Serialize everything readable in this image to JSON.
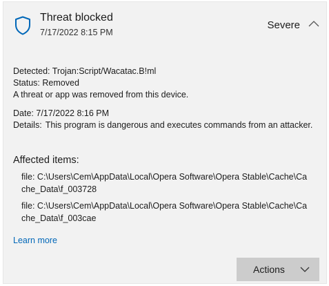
{
  "threat": {
    "title": "Threat blocked",
    "timestamp": "7/17/2022 8:15 PM",
    "severity": "Severe"
  },
  "details": {
    "detected_label": "Detected:",
    "detected_value": "Trojan:Script/Wacatac.B!ml",
    "status_label": "Status:",
    "status_value": "Removed",
    "status_message": "A threat or app was removed from this device.",
    "date_label": "Date:",
    "date_value": "7/17/2022 8:16 PM",
    "details_label": "Details:",
    "details_value": "This program is dangerous and executes commands from an attacker."
  },
  "affected": {
    "title": "Affected items:",
    "items": [
      "file: C:\\Users\\Cem\\AppData\\Local\\Opera Software\\Opera Stable\\Cache\\Cache_Data\\f_003728",
      "file: C:\\Users\\Cem\\AppData\\Local\\Opera Software\\Opera Stable\\Cache\\Cache_Data\\f_003cae"
    ]
  },
  "links": {
    "learn_more": "Learn more"
  },
  "actions": {
    "label": "Actions"
  },
  "icons": {
    "shield": "shield-icon",
    "collapse": "chevron-up-icon",
    "actions_dropdown": "chevron-down-icon"
  },
  "colors": {
    "card_background": "#f2f2f2",
    "accent": "#0067b8",
    "button_background": "#cccccc"
  }
}
